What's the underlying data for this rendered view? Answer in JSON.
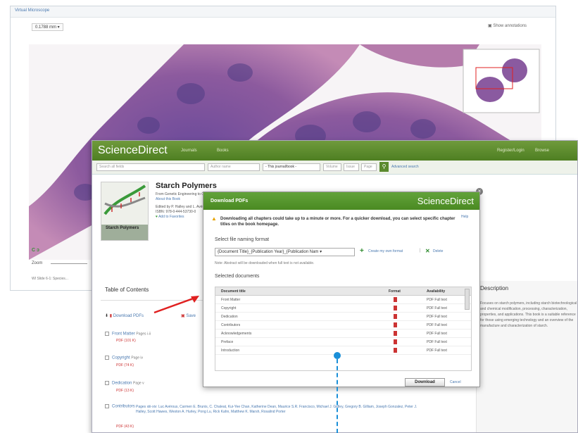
{
  "viewer": {
    "header_label": "Virtual Microscope",
    "zoom_select": "0.1788 mm",
    "annotations_label": "Show annotations",
    "zoom_label": "Zoom",
    "footer_text": "WI Slide 6-1: Species..."
  },
  "sciencedirect": {
    "logo": "ScienceDirect",
    "nav": [
      "Journals",
      "Books"
    ],
    "right_links": [
      "Register/Login",
      "Browse"
    ],
    "search_placeholders": [
      "Search all fields",
      "Author name",
      "- This journal/book -",
      "Volume",
      "Issue",
      "Page"
    ],
    "advanced_search": "Advanced search",
    "book": {
      "title": "Starch Polymers",
      "subtitle": "From Genetic Engineering to Green Applications",
      "about": "About this Book",
      "edited_by": "Edited by P. Halley and L. Avérous",
      "isbn": "ISBN: 978-0-444-53730-0",
      "favorites": "Add to Favorites",
      "cover_label": "Starch Polymers"
    },
    "toc": {
      "heading": "Table of Contents",
      "download_pdfs": "Download PDFs",
      "save": "Save",
      "items": [
        {
          "title": "Front Matter",
          "pages": "Pages i-ii",
          "pdf": "PDF (101 K)"
        },
        {
          "title": "Copyright",
          "pages": "Page iv",
          "pdf": "PDF (74 K)"
        },
        {
          "title": "Dedication",
          "pages": "Page v",
          "pdf": "PDF (13 K)"
        },
        {
          "title": "Contributors",
          "pages": "Pages xiii-xiv",
          "pdf": "PDF (43 K)"
        }
      ],
      "contributors_line": "Pages xiii-xiv: Luc Avérous, Carmen E. Brunis, C. Chaleat, Kui-Yee Chan, Katherine Dean, Maurice S.R. Francisco, Michael J. Gidley, Gregory B. Gilliam, Joseph Gonzalez, Peter J. Halley, Scott Hawes, Weston A. Hurley, Pong Lu, Rick Kahn, Matthew K. Marsh, Rosalind Porter"
    },
    "description": {
      "heading": "Description",
      "text": "Focuses on starch polymers, including starch biotechnological and chemical modification, processing, characterization, properties, and applications. This book is a suitable reference for those using emerging technology and an overview of the manufacture and characterization of starch."
    }
  },
  "modal": {
    "title": "Download PDFs",
    "brand": "ScienceDirect",
    "warning": "Downloading all chapters could take up to a minute or more. For a quicker download, you can select specific chapter titles on the book homepage.",
    "help": "Help",
    "format_label": "Select file naming format",
    "format_value": "{Document Title}_{Publication Year}_{Publication Nam",
    "create_format": "Create my own format",
    "delete": "Delete",
    "note": "Note: Abstract will be downloaded when full text is not available.",
    "selected_label": "Selected documents",
    "columns": {
      "title": "Document title",
      "format": "Format",
      "availability": "Availability"
    },
    "rows": [
      {
        "title": "Front Matter",
        "availability": "PDF Full text"
      },
      {
        "title": "Copyright",
        "availability": "PDF Full text"
      },
      {
        "title": "Dedication",
        "availability": "PDF Full text"
      },
      {
        "title": "Contributors",
        "availability": "PDF Full text"
      },
      {
        "title": "Acknowledgements",
        "availability": "PDF Full text"
      },
      {
        "title": "Preface",
        "availability": "PDF Full text"
      },
      {
        "title": "Introduction",
        "availability": "PDF Full text"
      }
    ],
    "download_button": "Download",
    "cancel": "Cancel"
  },
  "colors": {
    "sd_green": "#5b8a2e",
    "link_blue": "#4a79b0",
    "pdf_red": "#cc3333",
    "annotation_red": "#e02020",
    "cursor_blue": "#1a8fd8"
  }
}
